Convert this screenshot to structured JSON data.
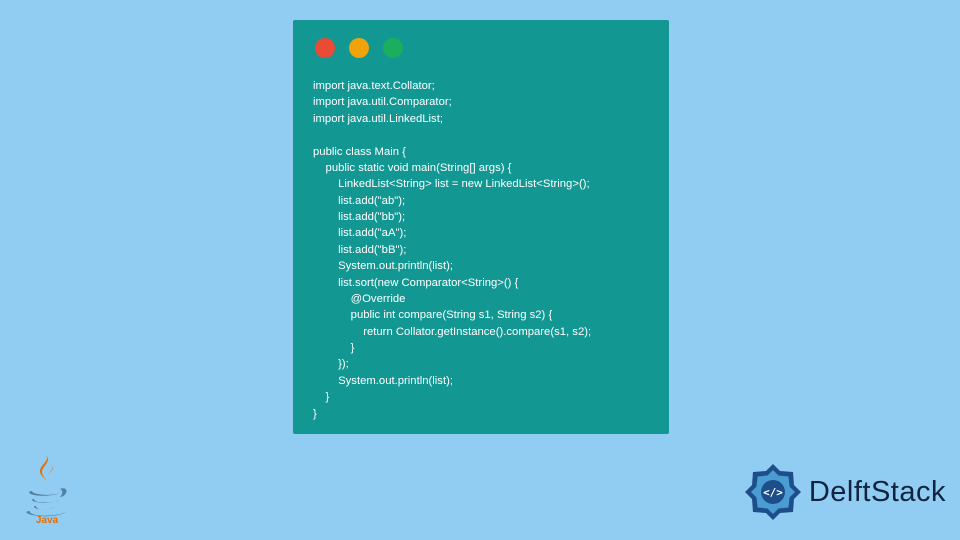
{
  "window": {
    "traffic_light_colors": {
      "red": "#e94b35",
      "yellow": "#f0a30a",
      "green": "#1aaf5d"
    },
    "background": "#129793"
  },
  "code": "import java.text.Collator;\nimport java.util.Comparator;\nimport java.util.LinkedList;\n\npublic class Main {\n    public static void main(String[] args) {\n        LinkedList<String> list = new LinkedList<String>();\n        list.add(\"ab\");\n        list.add(\"bb\");\n        list.add(\"aA\");\n        list.add(\"bB\");\n        System.out.println(list);\n        list.sort(new Comparator<String>() {\n            @Override\n            public int compare(String s1, String s2) {\n                return Collator.getInstance().compare(s1, s2);\n            }\n        });\n        System.out.println(list);\n    }\n}",
  "logos": {
    "java_label": "Java",
    "delft_label": "DelftStack"
  }
}
